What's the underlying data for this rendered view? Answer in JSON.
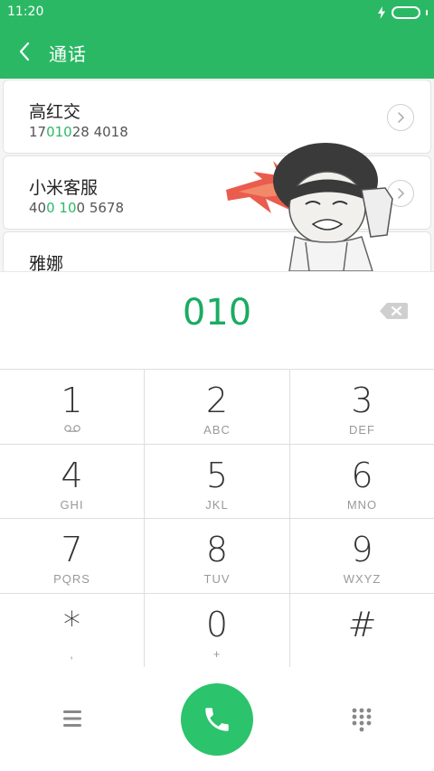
{
  "status_bar": {
    "time": "11:20"
  },
  "title_bar": {
    "title": "通话"
  },
  "contacts": [
    {
      "name": "高红交",
      "number_parts": [
        {
          "text": "17",
          "hl": false
        },
        {
          "text": "0",
          "hl": true
        },
        {
          "text": " ",
          "hl": false
        },
        {
          "text": "10",
          "hl": true
        },
        {
          "text": "28 4018",
          "hl": false
        }
      ]
    },
    {
      "name": "小米客服",
      "number_parts": [
        {
          "text": "40",
          "hl": false
        },
        {
          "text": "0",
          "hl": true
        },
        {
          "text": " ",
          "hl": false
        },
        {
          "text": "10",
          "hl": true
        },
        {
          "text": "0 5678",
          "hl": false
        }
      ]
    },
    {
      "name": "雅娜",
      "number_parts": []
    }
  ],
  "dialer": {
    "input": "010"
  },
  "keys": [
    {
      "digit": "1",
      "letters": "",
      "sub": "voicemail-icon"
    },
    {
      "digit": "2",
      "letters": "ABC"
    },
    {
      "digit": "3",
      "letters": "DEF"
    },
    {
      "digit": "4",
      "letters": "GHI"
    },
    {
      "digit": "5",
      "letters": "JKL"
    },
    {
      "digit": "6",
      "letters": "MNO"
    },
    {
      "digit": "7",
      "letters": "PQRS"
    },
    {
      "digit": "8",
      "letters": "TUV"
    },
    {
      "digit": "9",
      "letters": "WXYZ"
    },
    {
      "digit": "*",
      "letters": ","
    },
    {
      "digit": "0",
      "letters": "+"
    },
    {
      "digit": "#",
      "letters": ""
    }
  ],
  "colors": {
    "accent": "#2bb865",
    "call": "#2bc36b",
    "highlight": "#1aab63"
  }
}
